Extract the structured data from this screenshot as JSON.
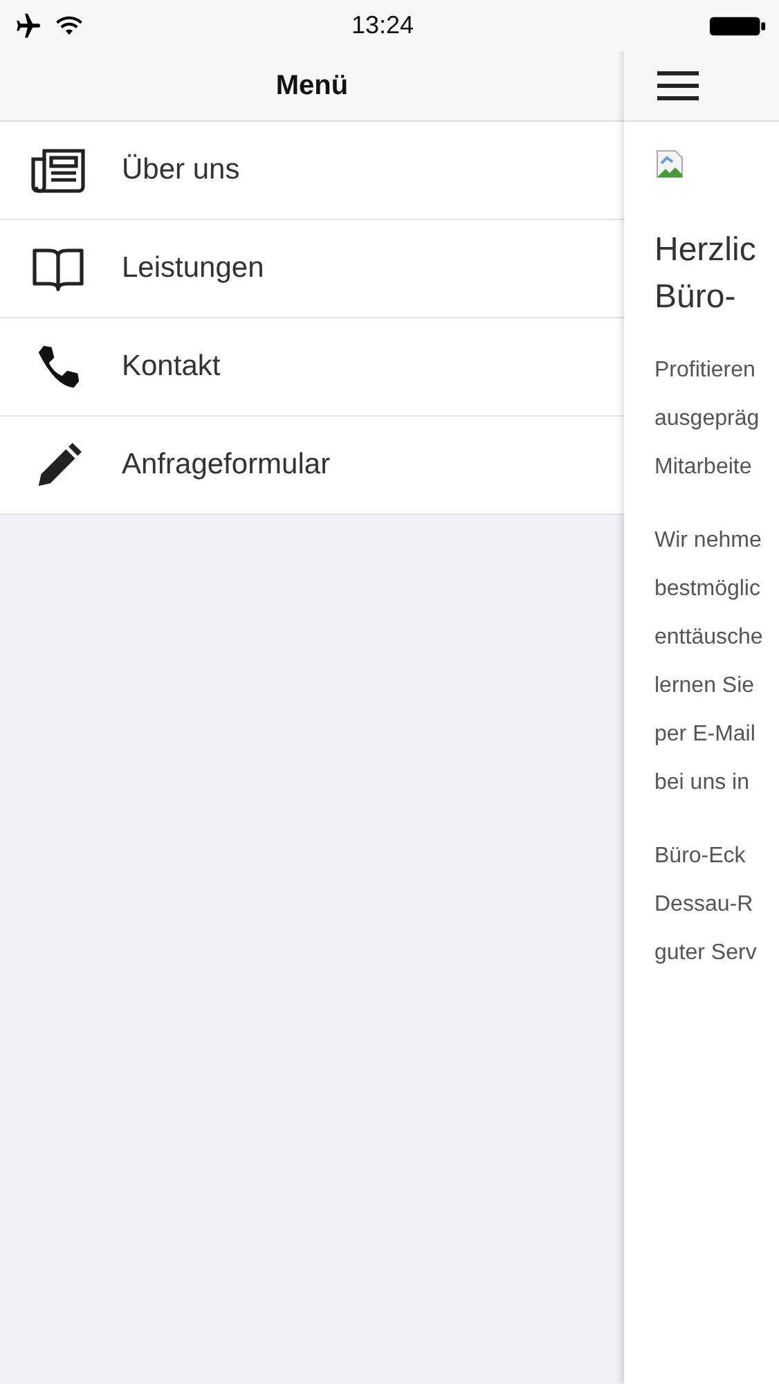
{
  "status_bar": {
    "time": "13:24"
  },
  "menu": {
    "title": "Menü",
    "items": [
      {
        "label": "Über uns"
      },
      {
        "label": "Leistungen"
      },
      {
        "label": "Kontakt"
      },
      {
        "label": "Anfrageformular"
      }
    ]
  },
  "content": {
    "heading_lines": [
      "Herzlic",
      "Büro-"
    ],
    "paragraphs": [
      [
        "Profitieren",
        "ausgepräg",
        "Mitarbeite"
      ],
      [
        "Wir nehme",
        "bestmöglic",
        "enttäusche",
        "lernen Sie",
        "per E-Mail",
        "bei uns in"
      ],
      [
        "Büro-Eck",
        "Dessau-R",
        "guter Serv"
      ]
    ]
  }
}
